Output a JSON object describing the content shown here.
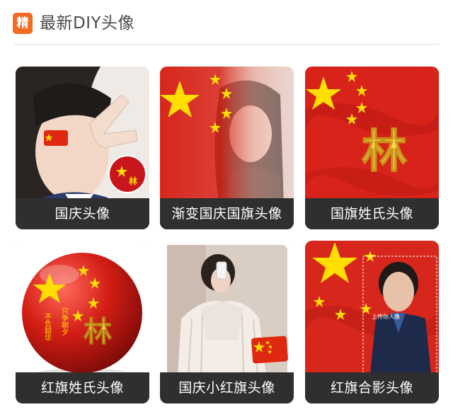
{
  "header": {
    "badge": "精",
    "title": "最新DIY头像"
  },
  "cards": [
    {
      "label": "国庆头像",
      "image": "girl-with-flag-sticker-and-badge"
    },
    {
      "label": "渐变国庆国旗头像",
      "image": "girl-with-gradient-flag"
    },
    {
      "label": "国旗姓氏头像",
      "image": "flag-with-surname-lin"
    },
    {
      "label": "红旗姓氏头像",
      "image": "flag-ball-with-surname-lin"
    },
    {
      "label": "国庆小红旗头像",
      "image": "girl-with-small-flag"
    },
    {
      "label": "红旗合影头像",
      "image": "man-with-flag-background"
    }
  ],
  "image_text": {
    "surname": "林",
    "ball_left": "不负韶华",
    "ball_right": "只争朝夕",
    "man_caption": "上传你人像"
  },
  "colors": {
    "badge": "#f06c21",
    "flag_red": "#de2910",
    "flag_gold": "#ffde00",
    "label_bg": "#2f2f2f"
  }
}
